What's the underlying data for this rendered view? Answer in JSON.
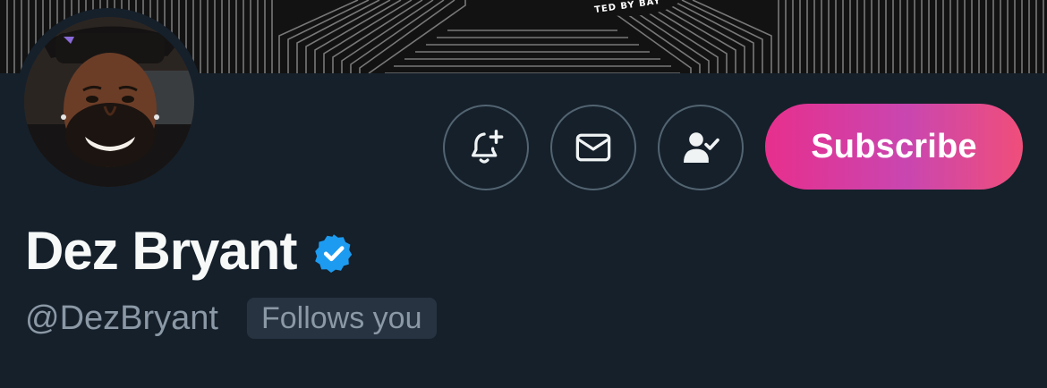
{
  "banner": {
    "partial_text": "TED BY BAY"
  },
  "profile": {
    "display_name": "Dez Bryant",
    "handle": "@DezBryant",
    "follows_you_label": "Follows you",
    "verified": true
  },
  "actions": {
    "notify_icon": "bell-plus-icon",
    "message_icon": "envelope-icon",
    "following_icon": "person-check-icon",
    "subscribe_label": "Subscribe"
  },
  "colors": {
    "background": "#15202b",
    "verified_blue": "#1d9bf0",
    "subscribe_gradient_start": "#e72f8d",
    "subscribe_gradient_end": "#f04e7a",
    "button_border": "#536471",
    "muted_text": "#8b98a5"
  }
}
